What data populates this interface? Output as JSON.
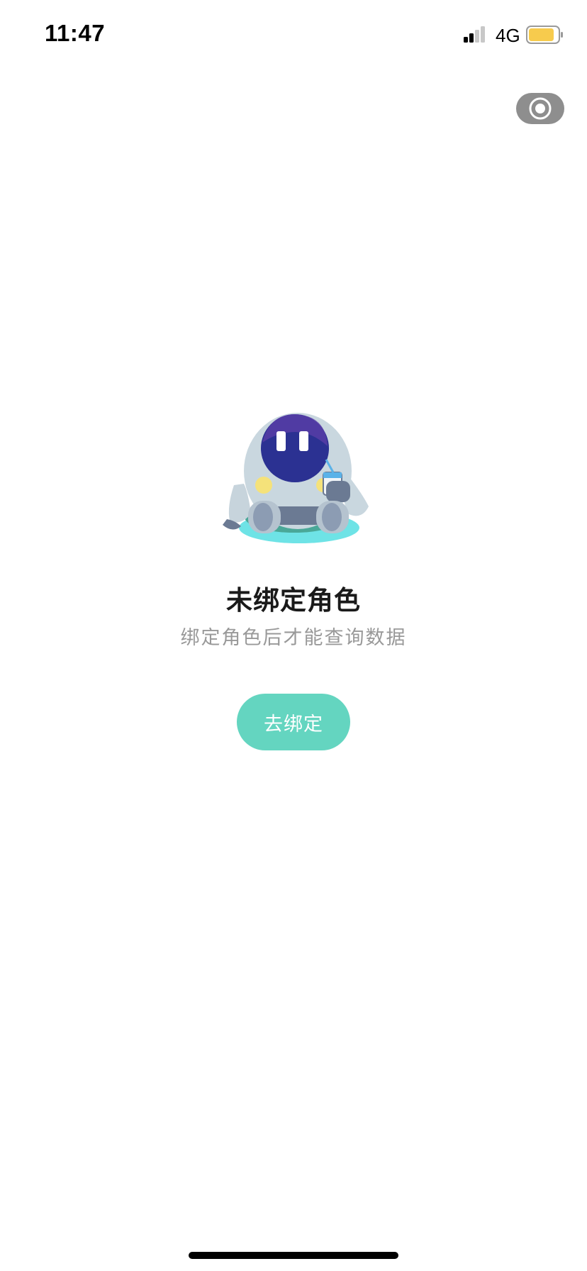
{
  "status_bar": {
    "time": "11:47",
    "network": "4G",
    "signal_icon": "signal-bars-icon",
    "battery_icon": "battery-icon",
    "battery_color": "#f7cb4d"
  },
  "capsule": {
    "icon": "record-target-icon"
  },
  "empty_state": {
    "illustration": "robot-mascot-illustration",
    "title": "未绑定角色",
    "subtitle": "绑定角色后才能查询数据",
    "button_label": "去绑定",
    "button_color": "#64d5c0"
  }
}
